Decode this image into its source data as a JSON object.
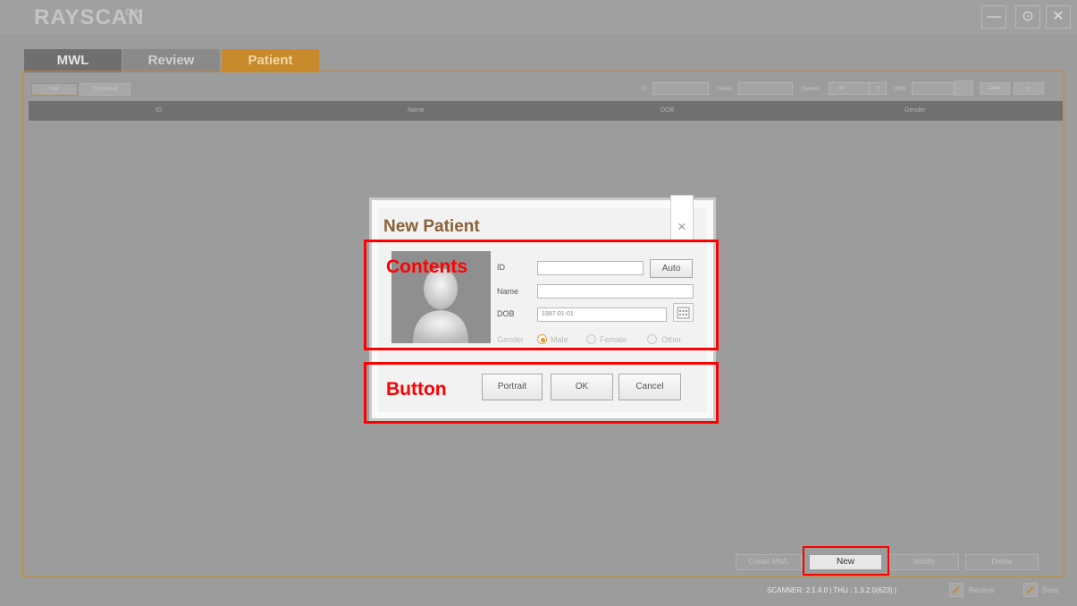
{
  "app": {
    "logo": "RAYSCAN",
    "logo_sup": "α+",
    "window_buttons": {
      "minimize": "—",
      "settings": "⊙",
      "close": "✕"
    }
  },
  "tabs": [
    {
      "label": "MWL"
    },
    {
      "label": "Review"
    },
    {
      "label": "Patient"
    }
  ],
  "toolbar": {
    "view_list": "List",
    "view_thumbnail": "Thumbnail",
    "id_label": "ID",
    "name_label": "Name",
    "gender_label": "Gender",
    "gender_value": "All",
    "dob_label": "DOB",
    "clear_label": "Clear",
    "search_icon": "search-icon"
  },
  "table": {
    "columns": [
      "ID",
      "Name",
      "DOB",
      "Gender"
    ]
  },
  "actions": {
    "create_mwl": "Create MWL",
    "new": "New",
    "modify": "Modify",
    "delete": "Delete"
  },
  "status": {
    "text": "SCANNER: 2.1.4.0 | THU : 1.3.2.0(623) |",
    "receive": "Receive",
    "send": "Send"
  },
  "dialog": {
    "title": "New Patient",
    "id_label": "ID",
    "id_value": "",
    "auto_label": "Auto",
    "name_label": "Name",
    "name_value": "",
    "dob_label": "DOB",
    "dob_value": "1997-01-01",
    "gender_label": "Gender",
    "gender_options": [
      "Male",
      "Female",
      "Other"
    ],
    "gender_selected": "Male",
    "portrait_label": "Portrait",
    "ok_label": "OK",
    "cancel_label": "Cancel"
  },
  "annotations": {
    "contents": "Contents",
    "button": "Button"
  },
  "colors": {
    "accent": "#c7892a",
    "annotation": "#ff0000",
    "dialog_title": "#8a6236"
  }
}
